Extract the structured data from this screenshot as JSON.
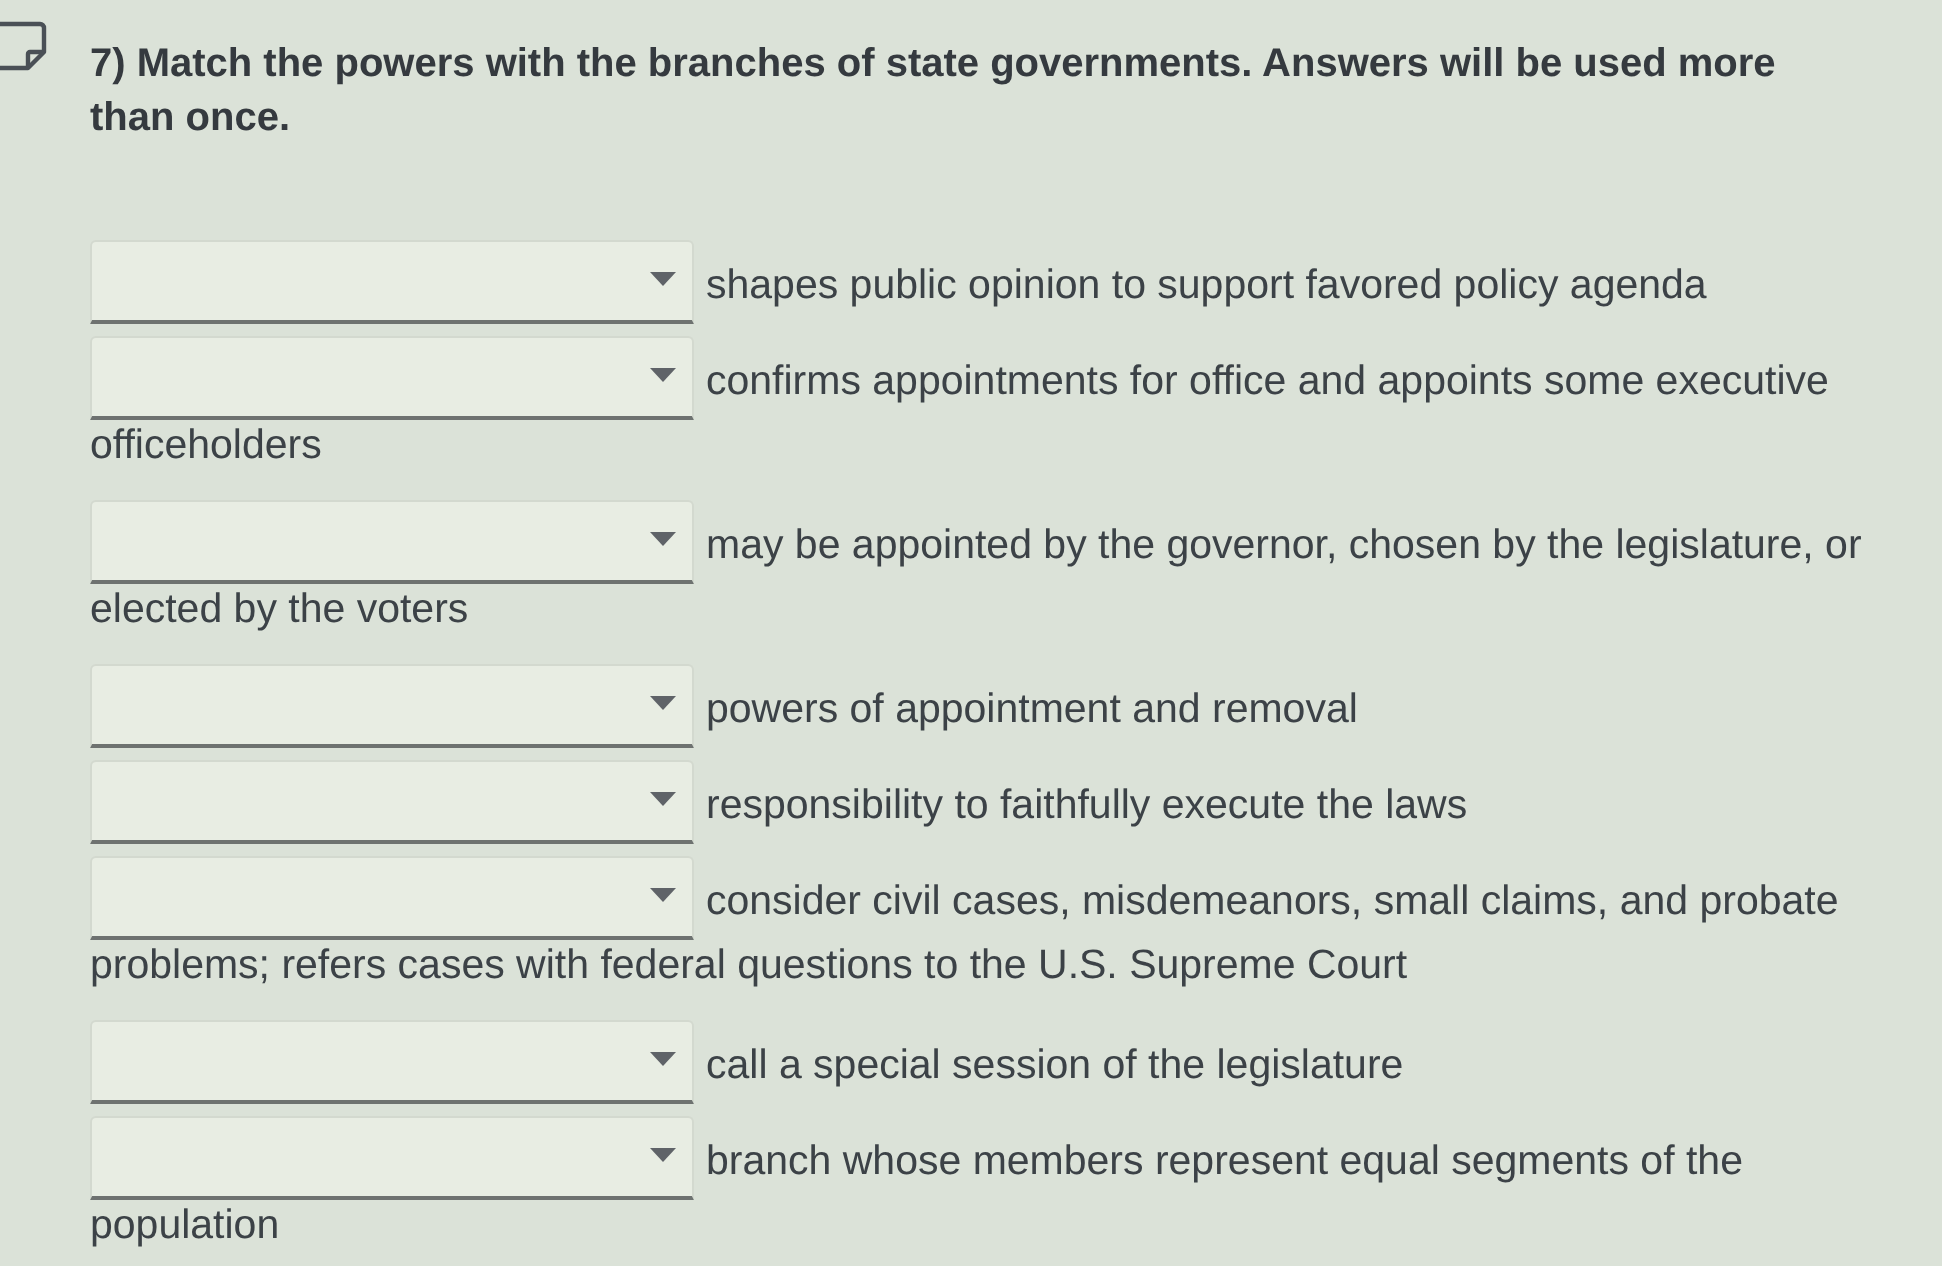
{
  "question": {
    "text": "7) Match the powers with the branches of state governments. Answers will be used more than once."
  },
  "items": [
    {
      "lines": [
        "shapes public opinion to support favored policy agenda"
      ]
    },
    {
      "lines": [
        "confirms appointments for office and appoints some executive",
        "officeholders"
      ]
    },
    {
      "lines": [
        "may be appointed by the governor, chosen by the legislature, or",
        "elected by the voters"
      ]
    },
    {
      "lines": [
        "powers of appointment and removal"
      ]
    },
    {
      "lines": [
        "responsibility to faithfully execute the laws"
      ]
    },
    {
      "lines": [
        "consider civil cases, misdemeanors, small claims, and probate",
        "problems; refers cases with federal questions to the U.S. Supreme Court"
      ]
    },
    {
      "lines": [
        "call a special session of the legislature"
      ]
    },
    {
      "lines": [
        "branch whose members represent equal segments of the",
        "population"
      ]
    }
  ]
}
